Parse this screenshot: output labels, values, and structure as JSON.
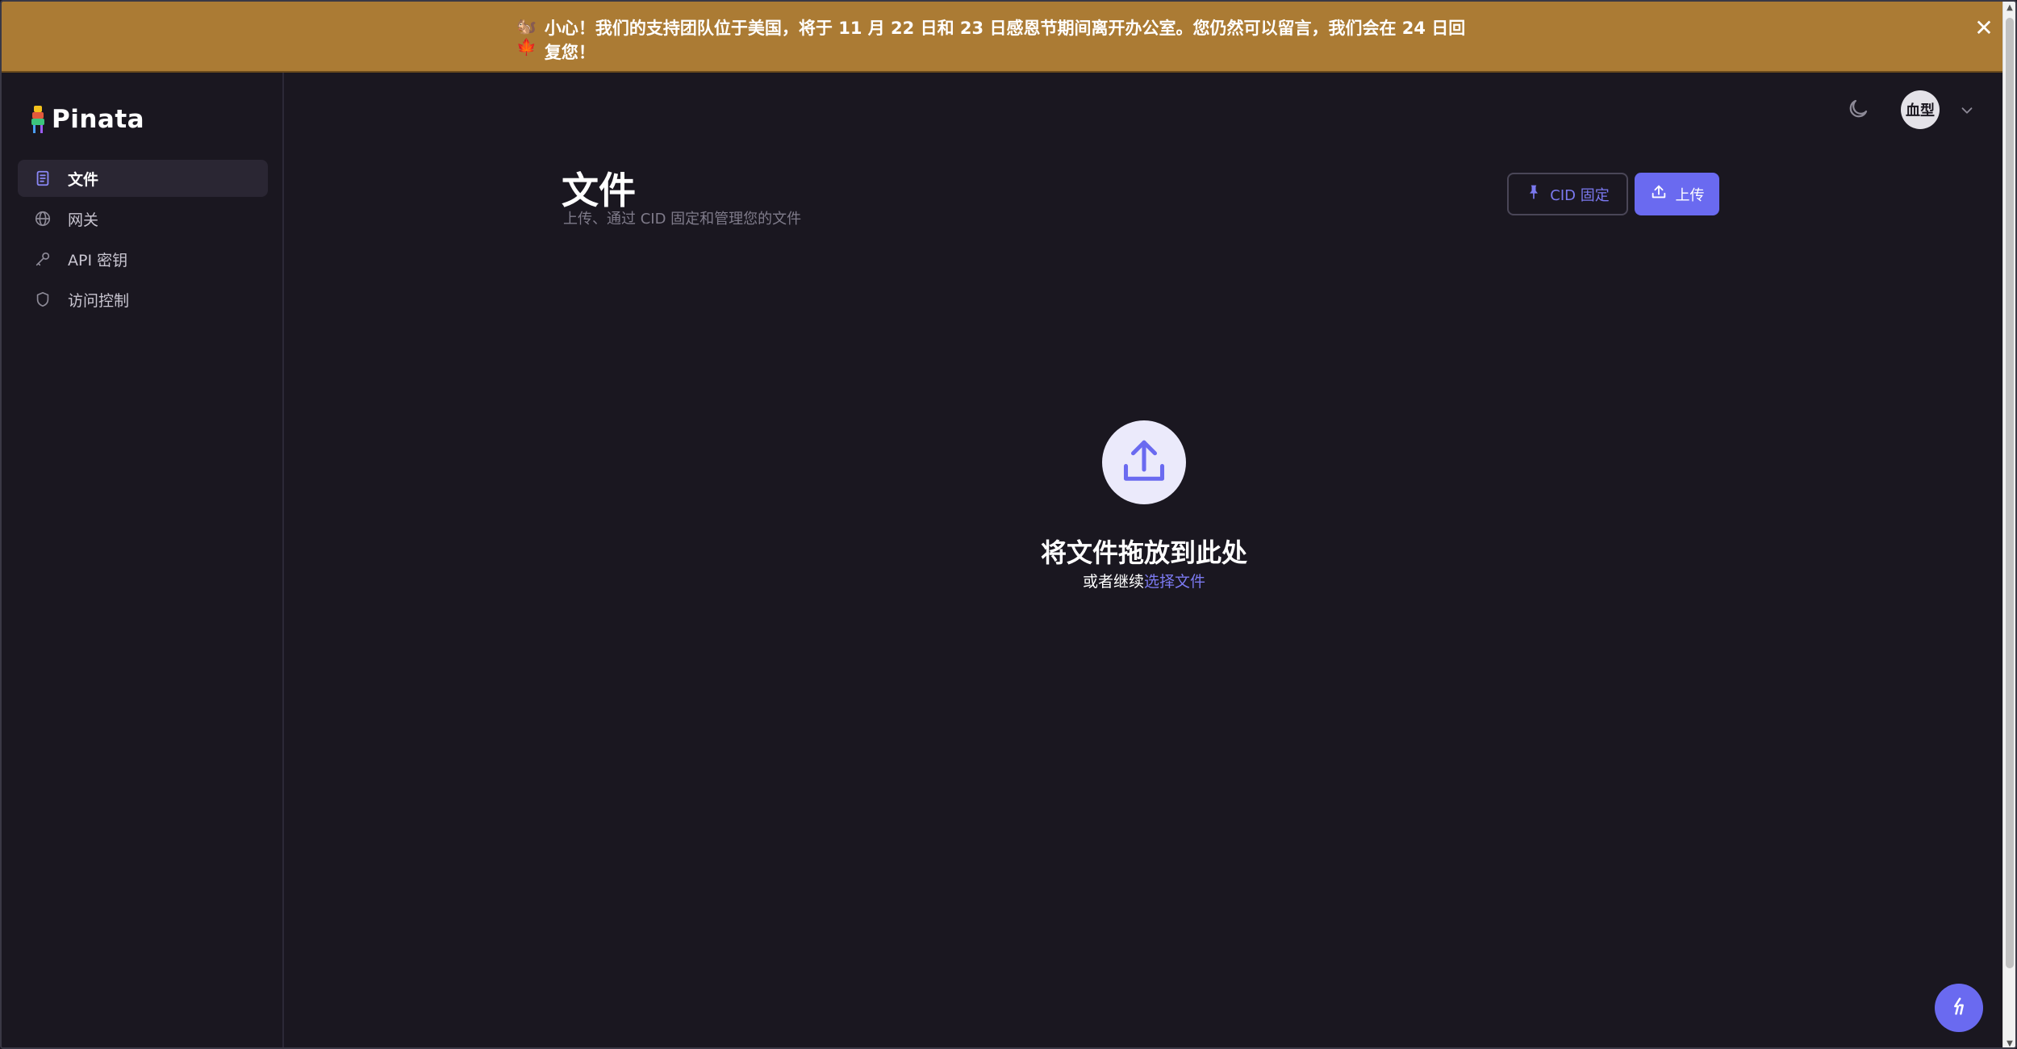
{
  "banner": {
    "icons": [
      "🐿️",
      "🍁"
    ],
    "text": "小心！我们的支持团队位于美国，将于 11 月 22 日和 23 日感恩节期间离开办公室。您仍然可以留言，我们会在 24 日回复您！",
    "close": "✕",
    "background": "#ab7b34"
  },
  "logo": {
    "text": "Pinata"
  },
  "sidebar": {
    "items": [
      {
        "label": "文件",
        "icon": "file-icon",
        "active": true
      },
      {
        "label": "网关",
        "icon": "globe-icon",
        "active": false
      },
      {
        "label": "API 密钥",
        "icon": "key-icon",
        "active": false
      },
      {
        "label": "访问控制",
        "icon": "shield-icon",
        "active": false
      }
    ]
  },
  "header": {
    "avatar_label": "血型",
    "theme_icon": "moon-icon",
    "menu_icon": "chevron-down-icon"
  },
  "page": {
    "title": "文件",
    "subtitle": "上传、通过 CID 固定和管理您的文件"
  },
  "actions": {
    "pin_cid": "CID 固定",
    "upload": "上传"
  },
  "dropzone": {
    "icon": "upload-icon",
    "title": "将文件拖放到此处",
    "prompt": "或者继续",
    "link": "选择文件"
  },
  "colors": {
    "background": "#1a1720",
    "accent": "#6a6af0",
    "accent_text": "#7b79f0"
  }
}
